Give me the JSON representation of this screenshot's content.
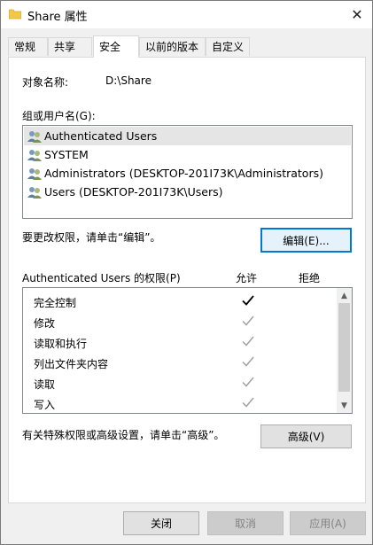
{
  "window": {
    "title": "Share 属性",
    "close_glyph": "✕"
  },
  "tabs": [
    {
      "label": "常规"
    },
    {
      "label": "共享"
    },
    {
      "label": "安全",
      "active": true
    },
    {
      "label": "以前的版本"
    },
    {
      "label": "自定义"
    }
  ],
  "security": {
    "object_name_label": "对象名称:",
    "object_name_value": "D:\\Share",
    "group_label": "组或用户名(G):",
    "groups": [
      {
        "name": "Authenticated Users",
        "selected": true
      },
      {
        "name": "SYSTEM"
      },
      {
        "name": "Administrators (DESKTOP-201I73K\\Administrators)"
      },
      {
        "name": "Users (DESKTOP-201I73K\\Users)"
      }
    ],
    "edit_hint": "要更改权限，请单击“编辑”。",
    "edit_button": "编辑(E)...",
    "perm_header": "Authenticated Users 的权限(P)",
    "allow_header": "允许",
    "deny_header": "拒绝",
    "permissions": [
      {
        "name": "完全控制",
        "allow": true,
        "inherited": false
      },
      {
        "name": "修改",
        "allow": true,
        "inherited": true
      },
      {
        "name": "读取和执行",
        "allow": true,
        "inherited": true
      },
      {
        "name": "列出文件夹内容",
        "allow": true,
        "inherited": true
      },
      {
        "name": "读取",
        "allow": true,
        "inherited": true
      },
      {
        "name": "写入",
        "allow": true,
        "inherited": true
      }
    ],
    "advanced_hint": "有关特殊权限或高级设置，请单击“高级”。",
    "advanced_button": "高级(V)"
  },
  "footer": {
    "close_button": "关闭",
    "cancel_button": "取消",
    "apply_button": "应用(A)"
  },
  "colors": {
    "accent": "#0078d7",
    "check_active": "#000000",
    "check_inherited": "#a0a0a0"
  }
}
